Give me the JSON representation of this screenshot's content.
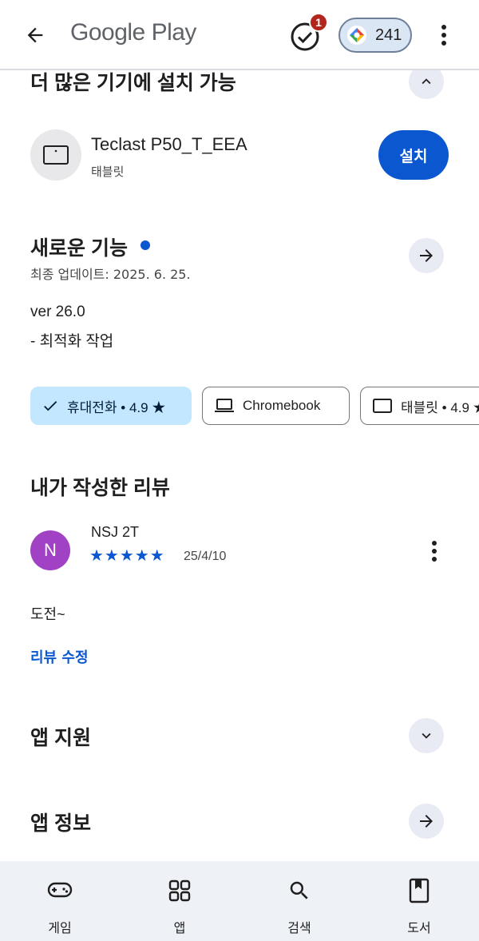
{
  "header": {
    "title": "Google Play",
    "tasks_badge": "1",
    "points": "241"
  },
  "devices_section": {
    "heading": "더 많은 기기에 설치 가능",
    "device_name": "Teclast P50_T_EEA",
    "device_type": "태블릿",
    "install_label": "설치"
  },
  "whats_new": {
    "heading": "새로운 기능",
    "updated": "최종 업데이트: 2025. 6. 25.",
    "version": "ver 26.0",
    "note": "- 최적화 작업"
  },
  "device_chips": [
    {
      "label": "휴대전화 • 4.9 ★",
      "selected": true,
      "icon": "check-icon"
    },
    {
      "label": "Chromebook",
      "selected": false,
      "icon": "laptop-icon"
    },
    {
      "label": "태블릿 • 4.9 ★",
      "selected": false,
      "icon": "tablet-icon"
    }
  ],
  "my_review": {
    "heading": "내가 작성한 리뷰",
    "avatar_initial": "N",
    "reviewer": "NSJ 2T",
    "stars": "★★★★★",
    "rating": 5,
    "date": "25/4/10",
    "text": "도전~",
    "edit_label": "리뷰 수정"
  },
  "app_support": {
    "heading": "앱 지원"
  },
  "app_info": {
    "heading": "앱 정보"
  },
  "bottom_nav": [
    {
      "label": "게임",
      "icon": "gamepad-icon"
    },
    {
      "label": "앱",
      "icon": "apps-grid-icon"
    },
    {
      "label": "검색",
      "icon": "search-icon"
    },
    {
      "label": "도서",
      "icon": "book-icon"
    }
  ],
  "colors": {
    "accent": "#0b57d0",
    "chip_selected": "#c2e7ff",
    "avatar": "#a142c4",
    "badge": "#b3261e",
    "nav_bg": "#eef1f6"
  }
}
